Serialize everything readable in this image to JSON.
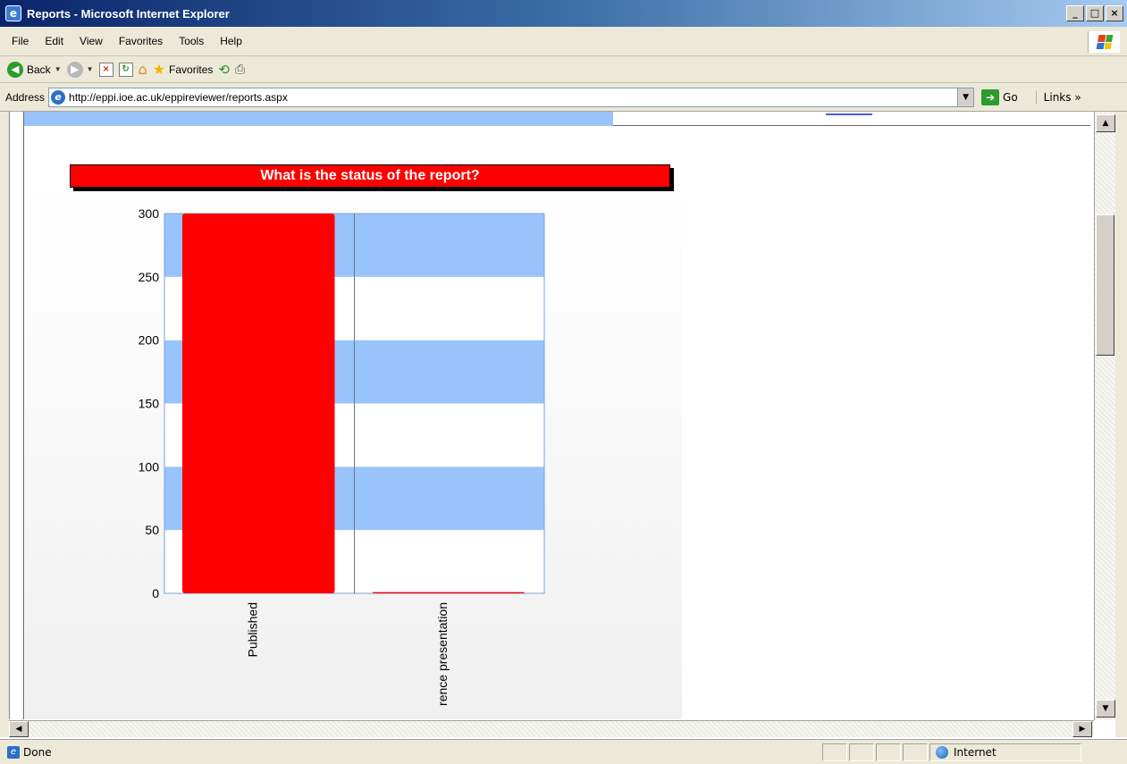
{
  "window": {
    "title": "Reports - Microsoft Internet Explorer",
    "minimize": "_",
    "maximize": "□",
    "close": "×"
  },
  "menu": [
    "File",
    "Edit",
    "View",
    "Favorites",
    "Tools",
    "Help"
  ],
  "toolbar": {
    "back_label": "Back",
    "favorites_label": "Favorites"
  },
  "address": {
    "label": "Address",
    "url": "http://eppi.ioe.ac.uk/eppireviewer/reports.aspx",
    "go_label": "Go",
    "links_label": "Links"
  },
  "status": {
    "text": "Done",
    "zone": "Internet"
  },
  "chart_data": {
    "type": "bar",
    "title": "What is the status of the report?",
    "categories": [
      "Published",
      "rence presentation"
    ],
    "values": [
      300,
      1
    ],
    "ylim": [
      0,
      300
    ],
    "yticks": [
      0,
      50,
      100,
      150,
      200,
      250,
      300
    ],
    "xlabel": "",
    "ylabel": "",
    "grid": true,
    "bar_color": "#ff0000",
    "band_color": "#99c3fb"
  }
}
